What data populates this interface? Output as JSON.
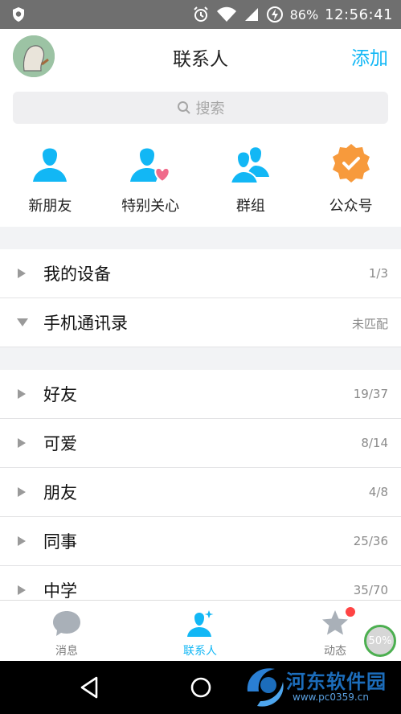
{
  "status_bar": {
    "battery": "86%",
    "time": "12:56:41"
  },
  "header": {
    "title": "联系人",
    "add_label": "添加"
  },
  "search": {
    "placeholder": "搜索"
  },
  "quick_entries": [
    {
      "label": "新朋友",
      "icon": "person-icon"
    },
    {
      "label": "特别关心",
      "icon": "person-heart-icon"
    },
    {
      "label": "群组",
      "icon": "group-icon"
    },
    {
      "label": "公众号",
      "icon": "verified-badge-icon"
    }
  ],
  "sections": [
    {
      "label": "我的设备",
      "count": "1/3",
      "expanded": false
    },
    {
      "label": "手机通讯录",
      "count": "未匹配",
      "expanded": true
    }
  ],
  "groups": [
    {
      "label": "好友",
      "count": "19/37"
    },
    {
      "label": "可爱",
      "count": "8/14"
    },
    {
      "label": "朋友",
      "count": "4/8"
    },
    {
      "label": "同事",
      "count": "25/36"
    },
    {
      "label": "中学",
      "count": "35/70"
    }
  ],
  "tabs": [
    {
      "label": "消息",
      "icon": "chat-bubble-icon",
      "active": false
    },
    {
      "label": "联系人",
      "icon": "contacts-icon",
      "active": true
    },
    {
      "label": "动态",
      "icon": "star-icon",
      "active": false
    }
  ],
  "progress_badge": "50%",
  "watermark": {
    "title": "河东软件园",
    "url": "www.pc0359.cn"
  },
  "colors": {
    "accent": "#12b7f5",
    "orange": "#f79a3c",
    "badge": "#ff4444"
  }
}
